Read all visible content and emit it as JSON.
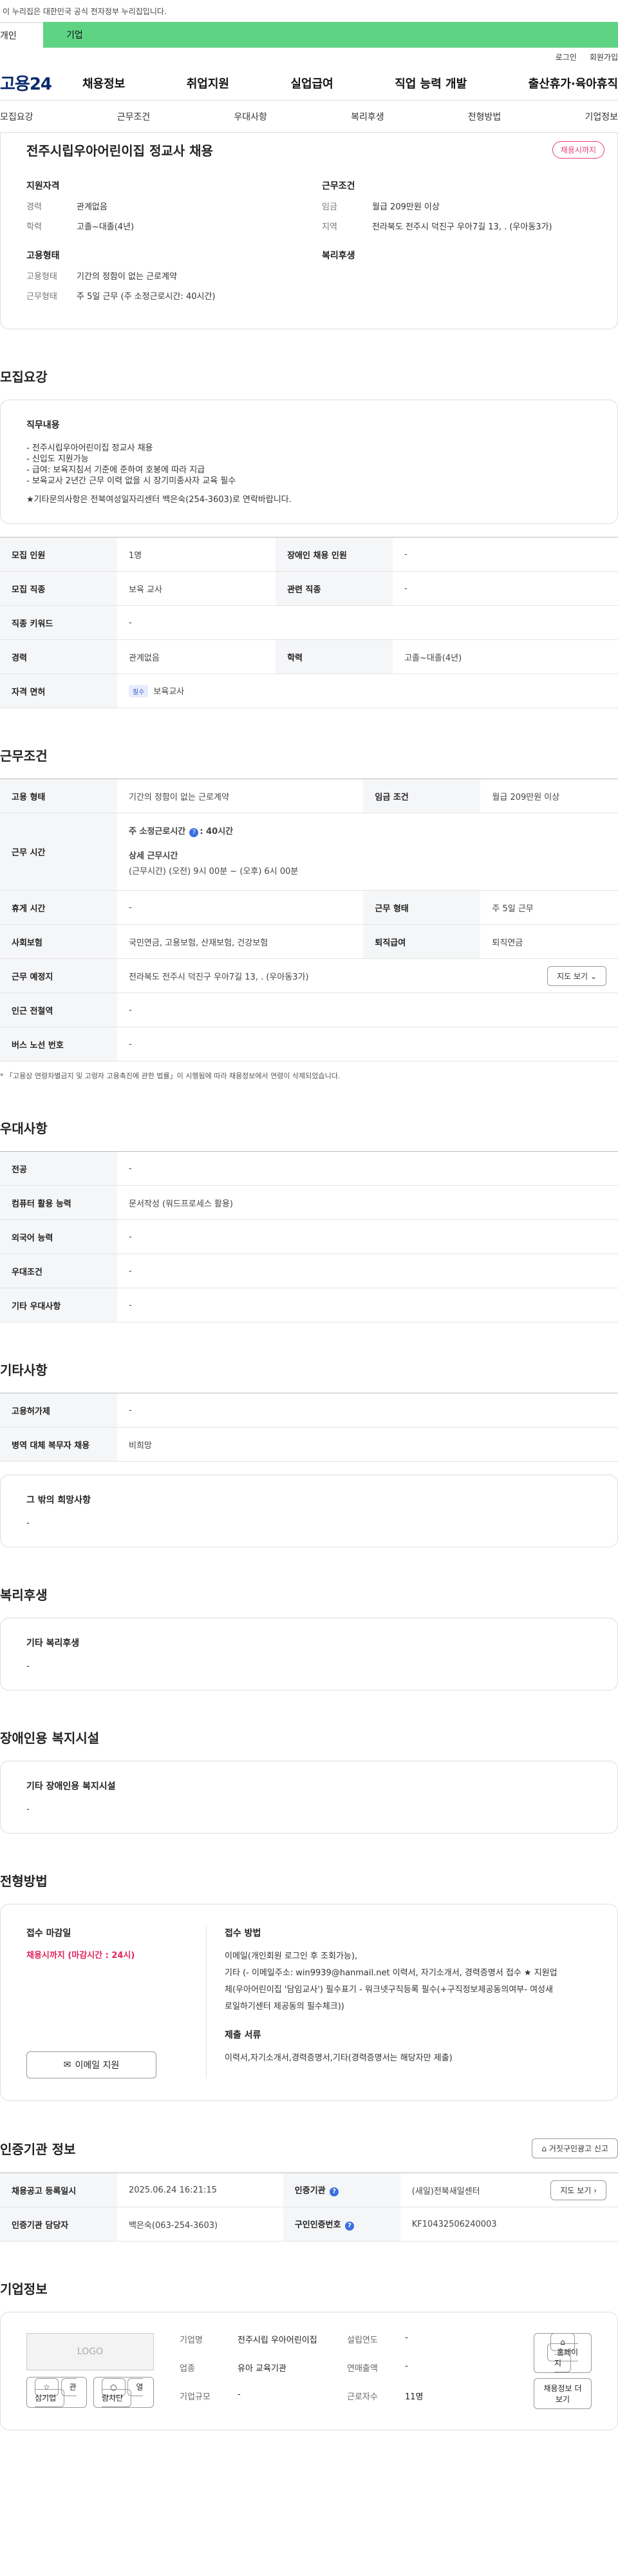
{
  "gov_banner": "이 누리집은 대한민국 공식 전자정부 누리집입니다.",
  "top_tabs": [
    "개인",
    "기업"
  ],
  "util_links": [
    "로그인",
    "회원가입"
  ],
  "logo": "고용24",
  "gnb": [
    "채용정보",
    "취업지원",
    "실업급여",
    "직업 능력 개발",
    "출산휴가·육아휴직"
  ],
  "subnav": [
    "모집요강",
    "근무조건",
    "우대사항",
    "복리후생",
    "전형방법",
    "기업정보"
  ],
  "job": {
    "title": "전주시립우아어린이집 정교사 채용",
    "status": "채용시까지",
    "qual_title": "지원자격",
    "qual": [
      [
        "경력",
        "관계없음"
      ],
      [
        "학력",
        "고졸~대졸(4년)"
      ]
    ],
    "cond_title": "근무조건",
    "cond": [
      [
        "임금",
        "월급 209만원 이상"
      ],
      [
        "지역",
        "전라북도 전주시 덕진구 우아7길 13, . (우아동3가)"
      ]
    ],
    "emp_title": "고용형태",
    "emp": [
      [
        "고용형태",
        "기간의 정함이 없는 근로계약"
      ],
      [
        "근무형태",
        "주 5일 근무 (주 소정근로시간: 40시간)"
      ]
    ],
    "welfare_title": "복리후생"
  },
  "recruit": {
    "title": "모집요강",
    "duty_title": "직무내용",
    "duty_lines": [
      "- 전주시립우아어린이집 정교사 채용",
      "- 신입도 지원가능",
      "- 급여: 보육지침서 기준에 준하여 호봉에 따라 지급",
      "- 보육교사 2년간 근무 이력 없을 시 장기미종사자 교육 필수"
    ],
    "duty_contact": "★기타문의사항은 전북여성일자리센터 백은숙(254-3603)로 연락바랍니다.",
    "rows": [
      [
        [
          "모집 인원",
          "1명"
        ],
        [
          "장애인 채용 인원",
          "-"
        ]
      ],
      [
        [
          "모집 직종",
          "보육 교사"
        ],
        [
          "관련 직종",
          "-"
        ]
      ],
      [
        [
          "직종 키워드",
          "-"
        ]
      ],
      [
        [
          "경력",
          "관계없음"
        ],
        [
          "학력",
          "고졸~대졸(4년)"
        ]
      ]
    ],
    "license_label": "자격 면허",
    "license_tag": "필수",
    "license_value": "보육교사"
  },
  "work": {
    "title": "근무조건",
    "emp_type_label": "고용 형태",
    "emp_type": "기간의 정함이 없는 근로계약",
    "wage_label": "임금 조건",
    "wage": "월급 209만원 이상",
    "hours_label": "근무 시간",
    "weekly_label": "주 소정근로시간",
    "weekly_value": ": 40시간",
    "detail_label": "상세 근무시간",
    "detail_value": "(근무시간) (오전) 9시 00분 ~ (오후) 6시 00분",
    "rest_label": "휴게 시간",
    "rest": "-",
    "shift_label": "근무 형태",
    "shift": "주 5일 근무",
    "insurance_label": "사회보험",
    "insurance": "국민연금, 고용보험, 산재보험, 건강보험",
    "retire_label": "퇴직급여",
    "retire": "퇴직연금",
    "place_label": "근무 예정지",
    "place": "전라북도 전주시 덕진구 우아7길 13, . (우아동3가)",
    "map_btn": "지도 보기",
    "station_label": "인근 전철역",
    "station": "-",
    "bus_label": "버스 노선 번호",
    "bus": "-",
    "note": "* 「고용상 연령차별금지 및 고령자 고용촉진에 관한 법률」이 시행됨에 따라 채용정보에서 연령이 삭제되었습니다."
  },
  "pref": {
    "title": "우대사항",
    "rows": [
      [
        "전공",
        "-"
      ],
      [
        "컴퓨터 활용 능력",
        "문서작성 (워드프로세스 활용)"
      ],
      [
        "외국어 능력",
        "-"
      ],
      [
        "우대조건",
        "-"
      ],
      [
        "기타 우대사항",
        "-"
      ]
    ]
  },
  "etc": {
    "title": "기타사항",
    "rows": [
      [
        "고용허가제",
        "-"
      ],
      [
        "병역 대체 복무자 채용",
        "비희망"
      ]
    ],
    "box_title": "그 밖의 희망사항",
    "box_value": "-"
  },
  "welfare": {
    "title": "복리후생",
    "box_title": "기타 복리후생",
    "box_value": "-"
  },
  "disabled": {
    "title": "장애인용 복지시설",
    "box_title": "기타 장애인용 복지시설",
    "box_value": "-"
  },
  "process": {
    "title": "전형방법",
    "deadline_title": "접수 마감일",
    "deadline": "채용시까지 (마감시간 : 24시)",
    "method_title": "접수 방법",
    "method_lines": [
      "이메일(개인회원 로그인 후 조회가능),",
      "기타 (- 이메일주소: win9939@hanmail.net 이력서, 자기소개서, 경력증명서 접수 ★ 지원업",
      "체(우아어린이집 '담임교사') 필수표기 - 워크넷구직등록 필수(+구직정보제공동의여부- 여성새",
      "로일하기센터 제공동의 필수체크))"
    ],
    "docs_title": "제출 서류",
    "docs": "이력서,자기소개서,경력증명서,기타(경력증명서는 해당자만 제출)",
    "email_btn": "이메일 지원"
  },
  "cert": {
    "title": "인증기관 정보",
    "report_btn": "거짓구인광고 신고",
    "reg_label": "채용공고 등록일시",
    "reg": "2025.06.24 16:21:15",
    "org_label": "인증기관",
    "org": "(새일)전북새일센터",
    "map_btn": "지도 보기",
    "mgr_label": "인증기관 담당자",
    "mgr": "백은숙(063-254-3603)",
    "no_label": "구인인증번호",
    "no": "KF10432506240003"
  },
  "company": {
    "title": "기업정보",
    "logo": "LOGO",
    "fav_btn": "관심기업",
    "block_btn": "열람차단",
    "name_label": "기업명",
    "name": "전주시립 우아어린이집",
    "year_label": "설립연도",
    "year": "-",
    "industry_label": "업종",
    "industry": "유아 교육기관",
    "sales_label": "연매출액",
    "sales": "-",
    "size_label": "기업규모",
    "size": "-",
    "staff_label": "근로자수",
    "staff": "11명",
    "home_btn": "홈페이지",
    "more_btn": "채용정보 더보기"
  }
}
